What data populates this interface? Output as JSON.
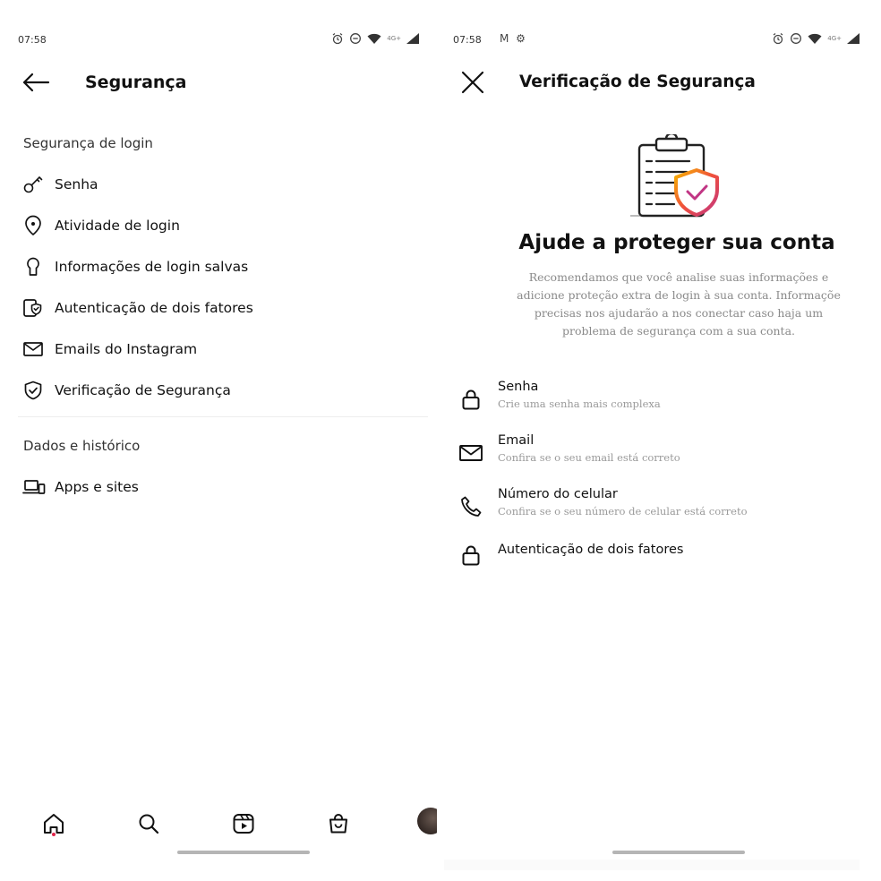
{
  "left": {
    "status": {
      "time": "07:58",
      "network": "4G+"
    },
    "header": {
      "title": "Segurança"
    },
    "sections": [
      {
        "title": "Segurança de login",
        "items": [
          {
            "label": "Senha",
            "icon": "key-icon"
          },
          {
            "label": "Atividade de login",
            "icon": "location-pin-icon"
          },
          {
            "label": "Informações de login salvas",
            "icon": "keyhole-icon"
          },
          {
            "label": "Autenticação de dois fatores",
            "icon": "two-factor-shield-icon"
          },
          {
            "label": "Emails do Instagram",
            "icon": "envelope-icon"
          },
          {
            "label": "Verificação de Segurança",
            "icon": "shield-check-icon"
          }
        ]
      },
      {
        "title": "Dados e histórico",
        "items": [
          {
            "label": "Apps e sites",
            "icon": "laptop-phone-icon"
          }
        ]
      }
    ],
    "bottom_nav": [
      "home-icon",
      "search-icon",
      "reels-icon",
      "shop-icon",
      "profile-avatar"
    ]
  },
  "right": {
    "status": {
      "time": "07:58",
      "notifications": "M ⚙",
      "network": "4G+"
    },
    "header": {
      "title": "Verificação de Segurança"
    },
    "headline": "Ajude a proteger sua conta",
    "description": "Recomendamos que você analise suas informações e\nadicione proteção extra de login à sua conta. Informaçõe\nprecisas nos ajudarão a nos conectar caso haja um\nproblema de segurança com a sua conta.",
    "items": [
      {
        "title": "Senha",
        "subtitle": "Crie uma senha mais complexa",
        "icon": "lock-icon"
      },
      {
        "title": "Email",
        "subtitle": "Confira se o seu email está correto",
        "icon": "envelope-icon"
      },
      {
        "title": "Número do celular",
        "subtitle": "Confira se o seu número de celular está correto",
        "icon": "phone-icon"
      },
      {
        "title": "Autenticação de dois fatores",
        "icon": "lock-icon"
      }
    ]
  },
  "colors": {
    "accent_gradient_start": "#f6b300",
    "accent_gradient_end": "#c13584",
    "notification_dot": "#e0244b"
  }
}
